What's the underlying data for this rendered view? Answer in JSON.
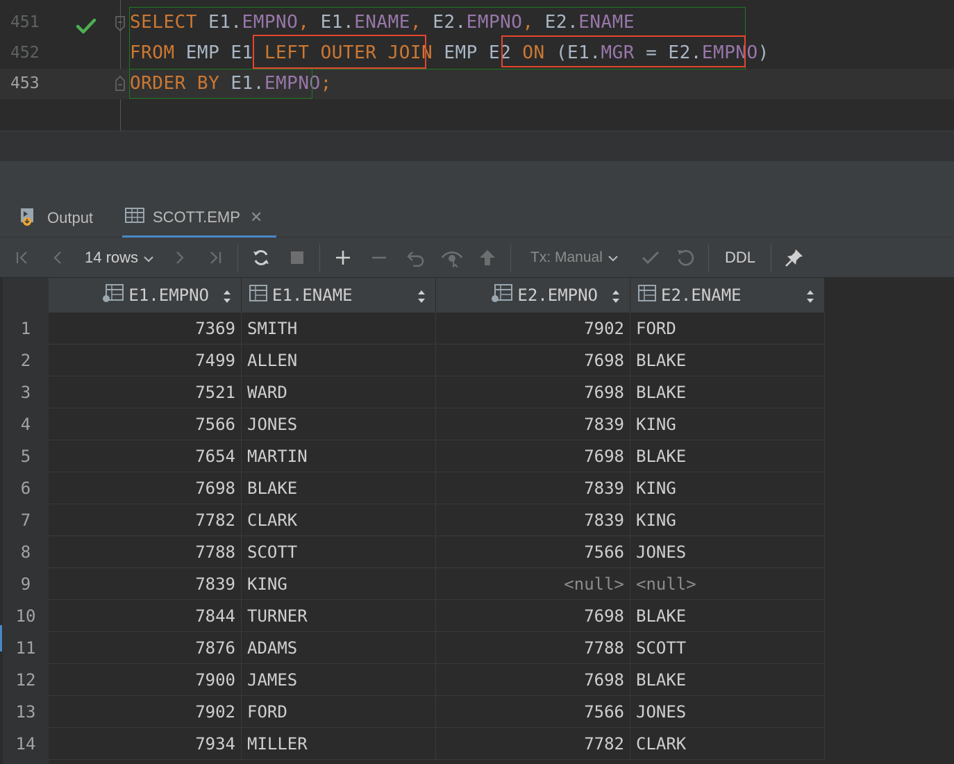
{
  "editor": {
    "lines": [
      {
        "num": "451",
        "tokens": [
          {
            "t": "SELECT",
            "c": "kw"
          },
          {
            "t": " E1.",
            "c": "plain"
          },
          {
            "t": "EMPNO",
            "c": "col"
          },
          {
            "t": ", ",
            "c": "kw"
          },
          {
            "t": "E1.",
            "c": "plain"
          },
          {
            "t": "ENAME",
            "c": "col"
          },
          {
            "t": ", ",
            "c": "kw"
          },
          {
            "t": "E2.",
            "c": "plain"
          },
          {
            "t": "EMPNO",
            "c": "col"
          },
          {
            "t": ", ",
            "c": "kw"
          },
          {
            "t": "E2.",
            "c": "plain"
          },
          {
            "t": "ENAME",
            "c": "col"
          }
        ]
      },
      {
        "num": "452",
        "tokens": [
          {
            "t": "FROM",
            "c": "kw"
          },
          {
            "t": " EMP E1 ",
            "c": "plain"
          },
          {
            "t": "LEFT OUTER JOIN",
            "c": "kw"
          },
          {
            "t": " EMP E2 ",
            "c": "plain"
          },
          {
            "t": "ON",
            "c": "kw"
          },
          {
            "t": " (E1.",
            "c": "plain"
          },
          {
            "t": "MGR",
            "c": "col"
          },
          {
            "t": " = E2.",
            "c": "plain"
          },
          {
            "t": "EMPNO",
            "c": "col"
          },
          {
            "t": ")",
            "c": "plain"
          }
        ]
      },
      {
        "num": "453",
        "tokens": [
          {
            "t": "ORDER BY",
            "c": "kw"
          },
          {
            "t": " E1.",
            "c": "plain"
          },
          {
            "t": "EMPNO",
            "c": "col"
          },
          {
            "t": ";",
            "c": "kw"
          }
        ]
      }
    ],
    "colors": {
      "keyword": "#cc7832",
      "column": "#9876aa",
      "plain": "#a9b7c6",
      "check": "#4caf50",
      "highlight_box": "#e5452c",
      "selection_box": "#1f7a1f"
    }
  },
  "tabs": [
    {
      "label": "Output",
      "icon": "output-icon",
      "active": false
    },
    {
      "label": "SCOTT.EMP",
      "icon": "table-icon",
      "active": true
    }
  ],
  "toolbar": {
    "rows_label": "14 rows",
    "tx_label": "Tx: Manual",
    "ddl_label": "DDL"
  },
  "grid": {
    "columns": [
      "E1.EMPNO",
      "E1.ENAME",
      "E2.EMPNO",
      "E2.ENAME"
    ],
    "rows": [
      {
        "n": "1",
        "c": [
          "7369",
          "SMITH",
          "7902",
          "FORD"
        ]
      },
      {
        "n": "2",
        "c": [
          "7499",
          "ALLEN",
          "7698",
          "BLAKE"
        ]
      },
      {
        "n": "3",
        "c": [
          "7521",
          "WARD",
          "7698",
          "BLAKE"
        ]
      },
      {
        "n": "4",
        "c": [
          "7566",
          "JONES",
          "7839",
          "KING"
        ]
      },
      {
        "n": "5",
        "c": [
          "7654",
          "MARTIN",
          "7698",
          "BLAKE"
        ]
      },
      {
        "n": "6",
        "c": [
          "7698",
          "BLAKE",
          "7839",
          "KING"
        ]
      },
      {
        "n": "7",
        "c": [
          "7782",
          "CLARK",
          "7839",
          "KING"
        ]
      },
      {
        "n": "8",
        "c": [
          "7788",
          "SCOTT",
          "7566",
          "JONES"
        ]
      },
      {
        "n": "9",
        "c": [
          "7839",
          "KING",
          "<null>",
          "<null>"
        ]
      },
      {
        "n": "10",
        "c": [
          "7844",
          "TURNER",
          "7698",
          "BLAKE"
        ]
      },
      {
        "n": "11",
        "c": [
          "7876",
          "ADAMS",
          "7788",
          "SCOTT"
        ]
      },
      {
        "n": "12",
        "c": [
          "7900",
          "JAMES",
          "7698",
          "BLAKE"
        ]
      },
      {
        "n": "13",
        "c": [
          "7902",
          "FORD",
          "7566",
          "JONES"
        ]
      },
      {
        "n": "14",
        "c": [
          "7934",
          "MILLER",
          "7782",
          "CLARK"
        ]
      }
    ]
  }
}
